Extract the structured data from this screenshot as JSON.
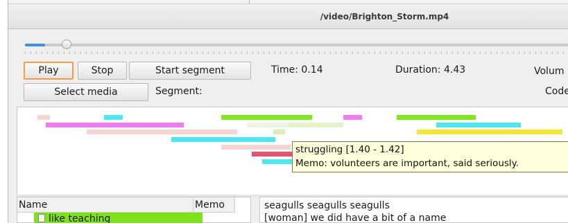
{
  "window": {
    "title": "/video/Brighton_Storm.mp4"
  },
  "player": {
    "progress_fraction": 0.037,
    "buttons": {
      "play": "Play",
      "stop": "Stop",
      "start_segment": "Start segment",
      "select_media": "Select media"
    },
    "time_label": "Time: 0.14",
    "duration_label": "Duration: 4.43",
    "volume_label": "Volum",
    "segment_label": "Segment:",
    "codec_label": "Code"
  },
  "timeline": {
    "segments_colors": [
      "#f7d4d4",
      "#f07cf0",
      "#50e6f0",
      "#7ee81a",
      "#e8f2cf",
      "#e8506e",
      "#f3e636"
    ],
    "tooltip": {
      "line1": "struggling [1.40 - 1.42]",
      "line2": "Memo: volunteers are important, said seriously."
    }
  },
  "codes_table": {
    "headers": {
      "name": "Name",
      "memo": "Memo"
    },
    "rows": [
      {
        "name": "like teaching",
        "color": "#7fe31b"
      }
    ]
  },
  "transcript": {
    "lines": [
      "seagulls seagulls seagulls",
      "[woman] we did have a bit of a name"
    ]
  }
}
